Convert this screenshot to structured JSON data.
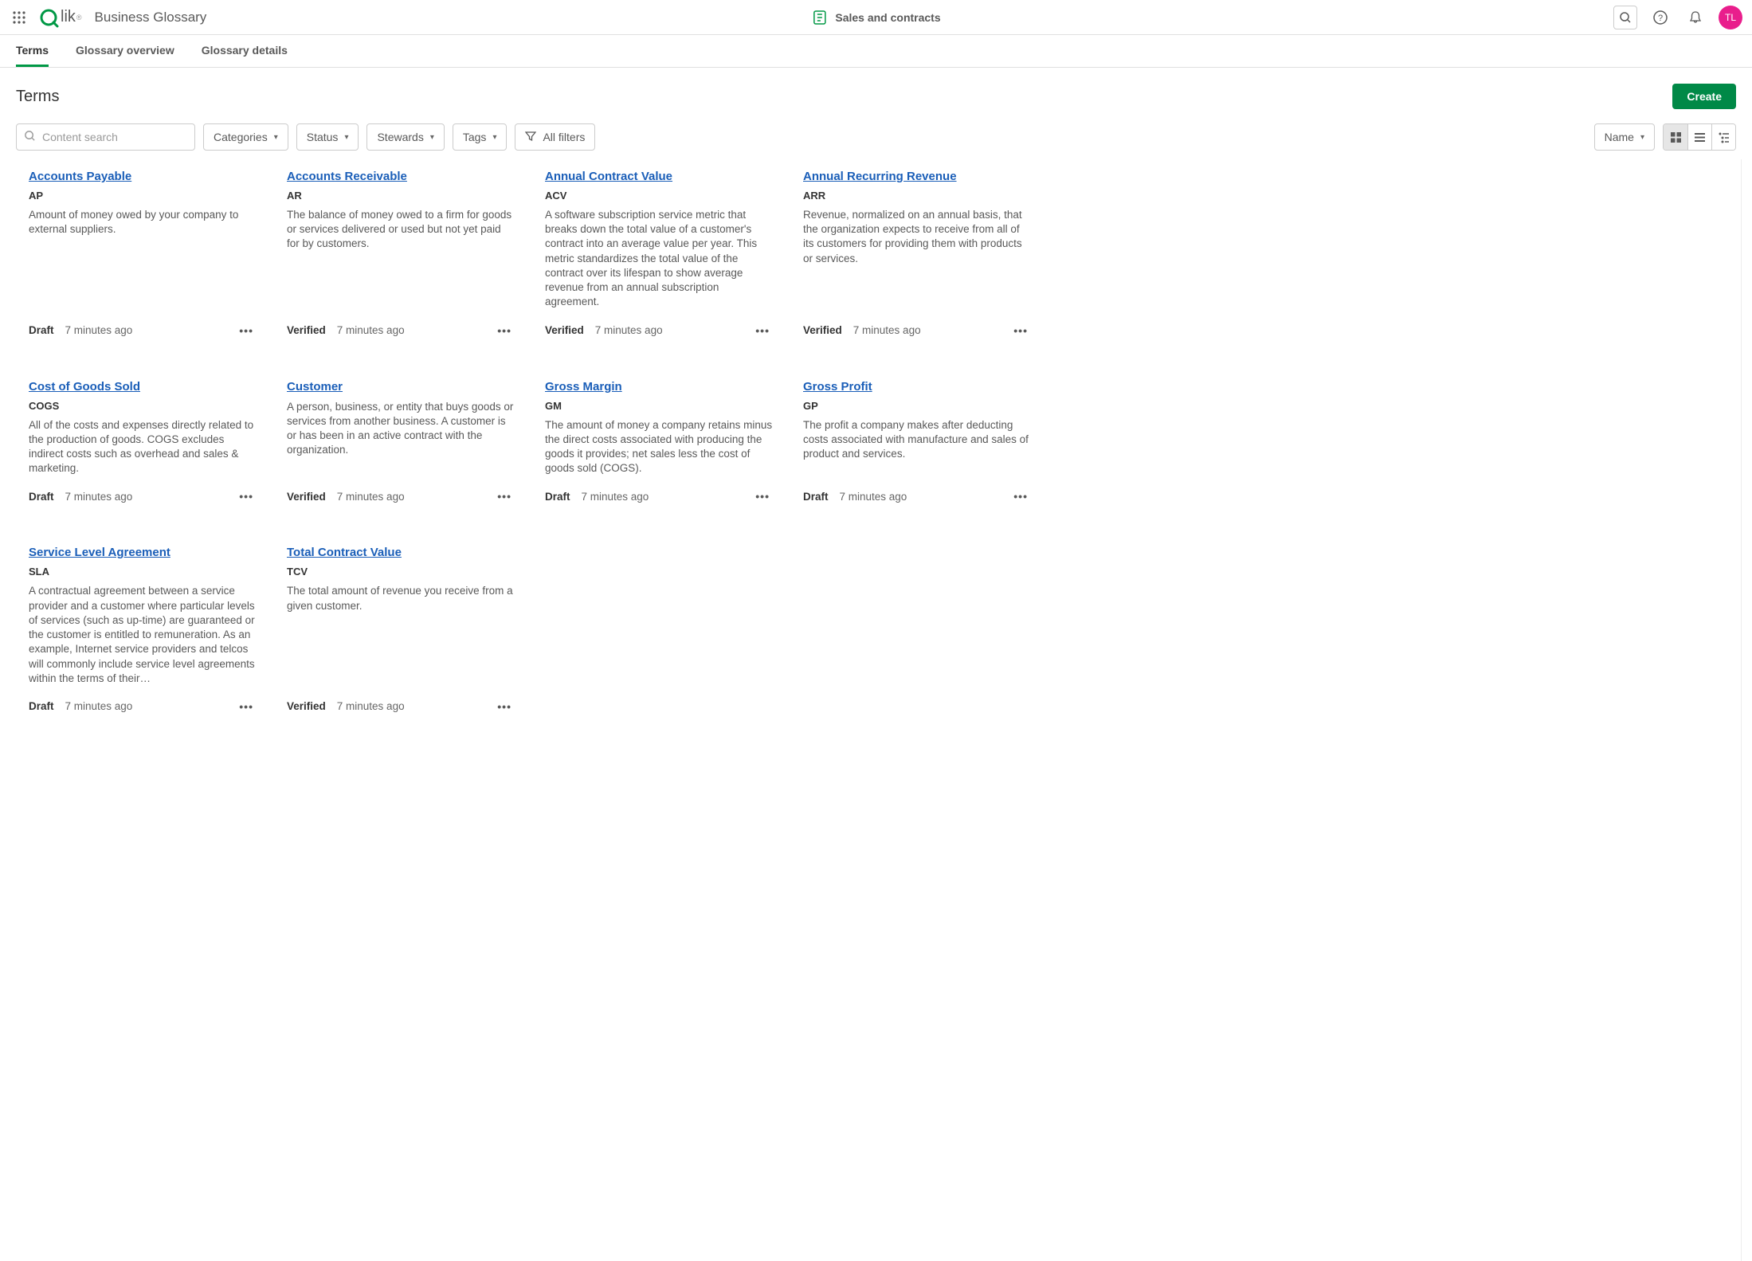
{
  "header": {
    "app_title": "Business Glossary",
    "center_label": "Sales and contracts",
    "avatar_initials": "TL"
  },
  "tabs": [
    {
      "label": "Terms",
      "active": true
    },
    {
      "label": "Glossary overview",
      "active": false
    },
    {
      "label": "Glossary details",
      "active": false
    }
  ],
  "page": {
    "title": "Terms",
    "create_label": "Create"
  },
  "toolbar": {
    "search_placeholder": "Content search",
    "categories_label": "Categories",
    "status_label": "Status",
    "stewards_label": "Stewards",
    "tags_label": "Tags",
    "all_filters_label": "All filters",
    "sort_label": "Name"
  },
  "cards": [
    {
      "title": "Accounts Payable",
      "abbr": "AP",
      "desc": "Amount of money owed by your company to external suppliers.",
      "status": "Draft",
      "time": "7 minutes ago"
    },
    {
      "title": "Accounts Receivable",
      "abbr": "AR",
      "desc": "The balance of money owed to a firm for goods or services delivered or used but not yet paid for by customers.",
      "status": "Verified",
      "time": "7 minutes ago"
    },
    {
      "title": "Annual Contract Value",
      "abbr": "ACV",
      "desc": "A software subscription service metric that breaks down the total value of a customer's contract into an average value per year. This metric standardizes the total value of the contract over its lifespan to show average revenue from an annual subscription agreement.",
      "status": "Verified",
      "time": "7 minutes ago"
    },
    {
      "title": "Annual Recurring Revenue",
      "abbr": "ARR",
      "desc": "Revenue, normalized on an annual basis, that the organization expects to receive from all of its customers for providing them with products or services.",
      "status": "Verified",
      "time": "7 minutes ago"
    },
    {
      "title": "Cost of Goods Sold",
      "abbr": "COGS",
      "desc": "All of the costs and expenses directly related to the production of goods. COGS excludes indirect costs such as overhead and sales & marketing.",
      "status": "Draft",
      "time": "7 minutes ago"
    },
    {
      "title": "Customer",
      "abbr": "",
      "desc": "A person, business, or entity that buys goods or services from another business. A customer is or has been in an active contract with the organization.",
      "status": "Verified",
      "time": "7 minutes ago"
    },
    {
      "title": "Gross Margin",
      "abbr": "GM",
      "desc": "The amount of money a company retains minus the direct costs associated with producing the goods it provides; net sales less the cost of goods sold (COGS).",
      "status": "Draft",
      "time": "7 minutes ago"
    },
    {
      "title": "Gross Profit",
      "abbr": "GP",
      "desc": "The profit a company makes after deducting costs associated with manufacture and sales of product and services.",
      "status": "Draft",
      "time": "7 minutes ago"
    },
    {
      "title": "Service Level Agreement",
      "abbr": "SLA",
      "desc": "A contractual agreement between a service provider and a customer where particular levels of services (such as up-time) are guaranteed or the customer is entitled to remuneration. As an example, Internet service providers and telcos will commonly include service level agreements within the terms of their…",
      "status": "Draft",
      "time": "7 minutes ago"
    },
    {
      "title": "Total Contract Value",
      "abbr": "TCV",
      "desc": "The total amount of revenue you receive from a given customer.",
      "status": "Verified",
      "time": "7 minutes ago"
    }
  ]
}
